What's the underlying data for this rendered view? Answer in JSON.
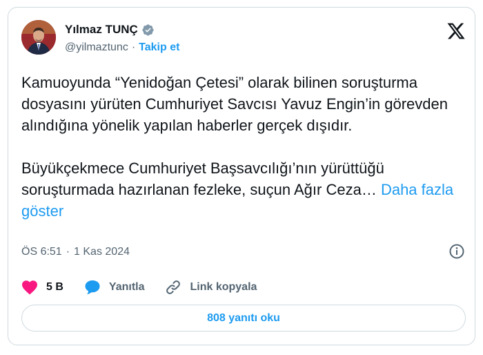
{
  "author": {
    "name": "Yılmaz TUNÇ",
    "handle": "@yilmaztunc",
    "separator": "·",
    "follow_label": "Takip et"
  },
  "tweet": {
    "paragraph1": "Kamuoyunda “Yenidoğan Çetesi” olarak bilinen soruşturma dosyasını yürüten Cumhuriyet Savcısı Yavuz Engin’in görevden alındığına yönelik yapılan haberler gerçek dışıdır.",
    "paragraph2": "Büyükçekmece Cumhuriyet Başsavcılığı’nın yürüttüğü soruşturmada hazırlanan fezleke, suçun Ağır Ceza…",
    "show_more": "Daha fazla göster"
  },
  "meta": {
    "time": "ÖS 6:51",
    "separator": "·",
    "date": "1 Kas 2024"
  },
  "actions": {
    "like_count": "5 B",
    "reply_label": "Yanıtla",
    "copy_link_label": "Link kopyala"
  },
  "read_replies": "808 yanıtı oku",
  "colors": {
    "accent": "#1d9bf0",
    "like": "#f91880",
    "text": "#0f1419",
    "muted": "#536471",
    "border": "#cfd9de"
  },
  "icons": {
    "verified": "verified-badge-icon",
    "logo": "x-logo-icon",
    "info": "info-icon",
    "like": "heart-icon",
    "reply": "reply-bubble-icon",
    "link": "link-icon"
  }
}
